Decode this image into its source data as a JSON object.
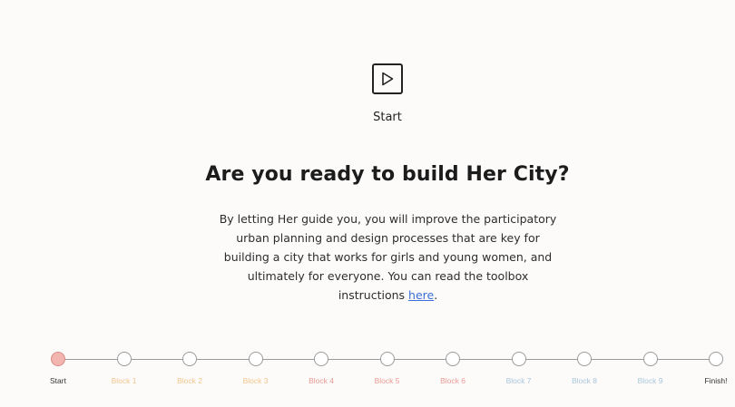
{
  "header": {
    "start_icon": "play-icon",
    "start_label": "Start"
  },
  "main": {
    "headline": "Are you ready to build Her City?",
    "intro_text": "By letting Her guide you, you will improve the participatory urban planning and design processes that are key for building a city that works for girls and young women, and ultimately for everyone. You can read the toolbox instructions ",
    "intro_link": "here",
    "intro_end": "."
  },
  "progress": {
    "steps": [
      {
        "label": "Start",
        "color": "#333333",
        "active": true
      },
      {
        "label": "Block 1",
        "color": "#f1c58c",
        "active": false
      },
      {
        "label": "Block 2",
        "color": "#f1c58c",
        "active": false
      },
      {
        "label": "Block 3",
        "color": "#f1c58c",
        "active": false
      },
      {
        "label": "Block 4",
        "color": "#eb9a94",
        "active": false
      },
      {
        "label": "Block 5",
        "color": "#eb9a94",
        "active": false
      },
      {
        "label": "Block 6",
        "color": "#eb9a94",
        "active": false
      },
      {
        "label": "Block 7",
        "color": "#a9c6db",
        "active": false
      },
      {
        "label": "Block 8",
        "color": "#a9c6db",
        "active": false
      },
      {
        "label": "Block 9",
        "color": "#a9c6db",
        "active": false
      },
      {
        "label": "Finish!",
        "color": "#333333",
        "active": false
      }
    ]
  }
}
